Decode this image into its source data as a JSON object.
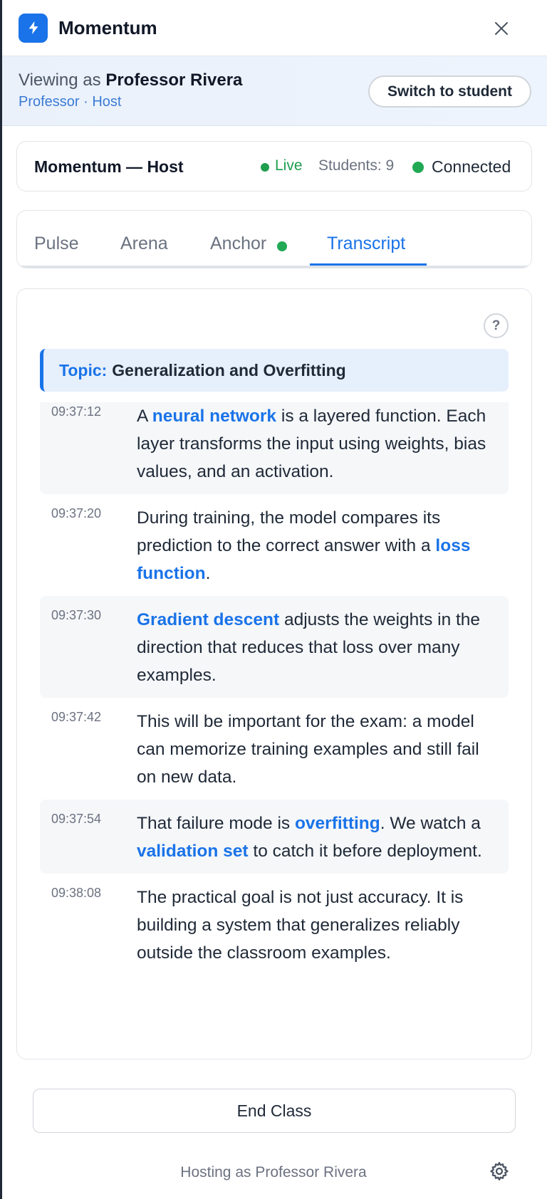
{
  "app": {
    "title": "Momentum"
  },
  "viewing": {
    "prefix": "Viewing as",
    "name": "Professor Rivera",
    "role_line": "Professor · Host",
    "switch_label": "Switch to student"
  },
  "status": {
    "title": "Momentum — Host",
    "live_label": "Live",
    "students_label": "Students: 9",
    "connection_label": "Connected"
  },
  "tabs": [
    {
      "label": "Pulse"
    },
    {
      "label": "Arena"
    },
    {
      "label": "Anchor"
    },
    {
      "label": "Transcript"
    }
  ],
  "active_tab": "Transcript",
  "transcript": {
    "help_label": "?",
    "topic_label": "Topic:",
    "topic_value": "Generalization and Overfitting",
    "entries": [
      {
        "time": "09:37:12",
        "parts": [
          "A ",
          "neural network",
          " is a layered function. Each layer transforms the input using weights, bias values, and an activation."
        ]
      },
      {
        "time": "09:37:20",
        "parts": [
          "During training, the model compares its prediction to the correct answer with a ",
          "loss function",
          "."
        ]
      },
      {
        "time": "09:37:30",
        "parts": [
          "",
          "Gradient descent",
          " adjusts the weights in the direction that reduces that loss over many examples."
        ]
      },
      {
        "time": "09:37:42",
        "parts": [
          "This will be important for the exam: a model can memorize training examples and still fail on new data."
        ]
      },
      {
        "time": "09:37:54",
        "parts": [
          "That failure mode is ",
          "overfitting",
          ". We watch a ",
          "validation set",
          " to catch it before deployment."
        ]
      },
      {
        "time": "09:38:08",
        "parts": [
          "The practical goal is not just accuracy. It is building a system that generalizes reliably outside the classroom examples."
        ]
      }
    ]
  },
  "footer": {
    "end_label": "End Class",
    "hosting_text": "Hosting as Professor Rivera"
  },
  "colors": {
    "accent": "#1a73e8",
    "live": "#1e9e4e",
    "connected": "#22a955"
  },
  "icons": {
    "logo": "lightning-bolt-icon",
    "close": "close-icon",
    "settings": "gear-icon"
  }
}
